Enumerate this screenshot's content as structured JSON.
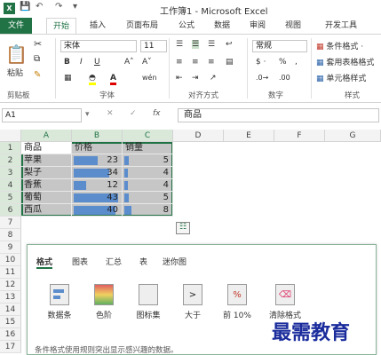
{
  "titlebar": {
    "app_icon": "X",
    "title": "工作簿1 - Microsoft Excel"
  },
  "tabs": [
    "文件",
    "开始",
    "插入",
    "页面布局",
    "公式",
    "数据",
    "审阅",
    "视图",
    "开发工具"
  ],
  "ribbon": {
    "font_name": "宋体",
    "font_size": "11",
    "number_format": "常规",
    "paste_label": "粘贴",
    "groups": [
      "剪贴板",
      "字体",
      "对齐方式",
      "数字",
      "样式"
    ],
    "styles_items": [
      "条件格式 ·",
      "套用表格格式",
      "单元格样式"
    ],
    "bold": "B",
    "italic": "I",
    "underline": "U",
    "grow_font": "A˄",
    "shrink_font": "A˅",
    "currency": "$ ·",
    "percent": "%",
    "comma": ","
  },
  "formula_bar": {
    "name_box": "A1",
    "fx": "fx",
    "content": "商品"
  },
  "columns": [
    "A",
    "B",
    "C",
    "D",
    "E",
    "F",
    "G"
  ],
  "rows": [
    "1",
    "2",
    "3",
    "4",
    "5",
    "6",
    "7",
    "8",
    "9",
    "10",
    "11",
    "12",
    "13",
    "14",
    "15",
    "16",
    "17"
  ],
  "table": {
    "header": [
      "商品",
      "价格",
      "销量"
    ],
    "data": [
      [
        "苹果",
        "23",
        "5"
      ],
      [
        "梨子",
        "34",
        "4"
      ],
      [
        "香蕉",
        "12",
        "4"
      ],
      [
        "葡萄",
        "43",
        "5"
      ],
      [
        "西瓜",
        "40",
        "8"
      ]
    ],
    "price_values": [
      23,
      34,
      12,
      43,
      40
    ],
    "qty_values": [
      5,
      4,
      4,
      5,
      8
    ]
  },
  "quick_analysis": {
    "tabs": [
      "格式",
      "图表",
      "汇总",
      "表",
      "迷你图"
    ],
    "items": [
      "数据条",
      "色阶",
      "图标集",
      "大于",
      "前 10%",
      "清除格式"
    ],
    "description": "条件格式使用规则突出显示感兴趣的数据。"
  },
  "watermark": "最需教育"
}
